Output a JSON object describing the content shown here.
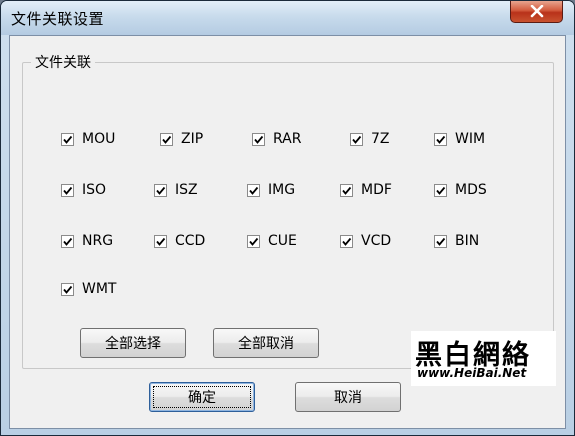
{
  "window": {
    "title": "文件关联设置"
  },
  "group": {
    "label": "文件关联"
  },
  "file_types": [
    {
      "label": "MOU",
      "checked": true
    },
    {
      "label": "ZIP",
      "checked": true
    },
    {
      "label": "RAR",
      "checked": true
    },
    {
      "label": "7Z",
      "checked": true
    },
    {
      "label": "WIM",
      "checked": true
    },
    {
      "label": "ISO",
      "checked": true
    },
    {
      "label": "ISZ",
      "checked": true
    },
    {
      "label": "IMG",
      "checked": true
    },
    {
      "label": "MDF",
      "checked": true
    },
    {
      "label": "MDS",
      "checked": true
    },
    {
      "label": "NRG",
      "checked": true
    },
    {
      "label": "CCD",
      "checked": true
    },
    {
      "label": "CUE",
      "checked": true
    },
    {
      "label": "VCD",
      "checked": true
    },
    {
      "label": "BIN",
      "checked": true
    },
    {
      "label": "WMT",
      "checked": true
    }
  ],
  "buttons": {
    "select_all": "全部选择",
    "deselect_all": "全部取消",
    "ok": "确定",
    "cancel": "取消"
  },
  "watermark": {
    "title": "黑白網絡",
    "url": "www.HeiBai.Net"
  }
}
